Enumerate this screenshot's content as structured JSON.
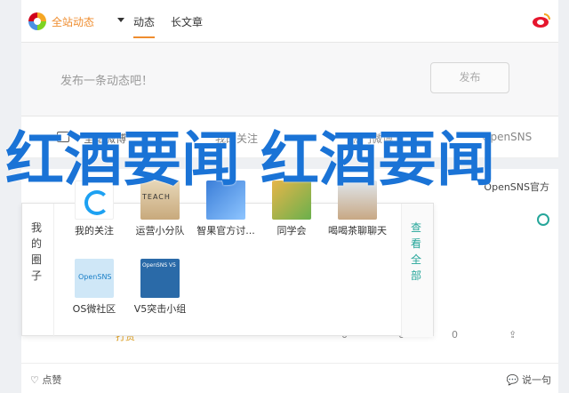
{
  "topnav": {
    "brand_label": "全站动态",
    "tabs": [
      "动态",
      "长文章"
    ]
  },
  "publish": {
    "placeholder": "发布一条动态吧！",
    "button_label": "发布"
  },
  "filters": [
    "全站微博",
    "我的关注",
    "热门微博",
    "OpenSNS"
  ],
  "feed": {
    "author": "OpenSNS官方",
    "reward": "打赏",
    "likes_count": "0",
    "comments_count": "0",
    "reposts_count": "0",
    "like_label": "点赞",
    "comment_label": "说一句"
  },
  "popup": {
    "left_label": [
      "我",
      "的",
      "圈",
      "子"
    ],
    "right_label": [
      "查",
      "看",
      "全",
      "部"
    ],
    "apps": [
      {
        "label": "我的关注"
      },
      {
        "label": "运营小分队"
      },
      {
        "label": "智果官方讨..."
      },
      {
        "label": "同学会"
      },
      {
        "label": "喝喝茶聊聊天"
      },
      {
        "label": "OS微社区"
      },
      {
        "label": "V5突击小组"
      }
    ]
  },
  "overlay": {
    "title": "红酒要闻 红酒要闻"
  },
  "colors": {
    "accent": "#ef8d2f",
    "teal": "#26a69a",
    "overlay_text": "#1a73d6"
  }
}
